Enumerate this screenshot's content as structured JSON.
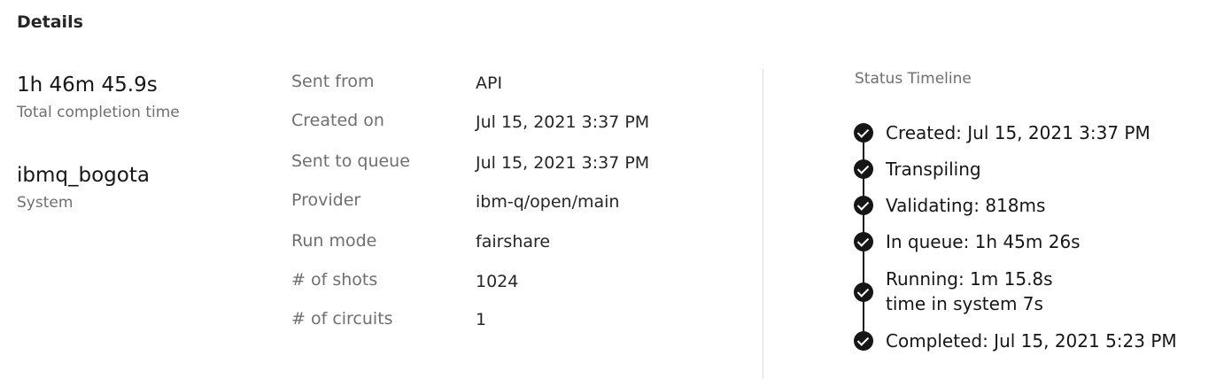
{
  "section_title": "Details",
  "summary": {
    "completion_time": "1h 46m 45.9s",
    "completion_time_label": "Total completion time",
    "system_name": "ibmq_bogota",
    "system_label": "System"
  },
  "properties": [
    {
      "label": "Sent from",
      "value": "API"
    },
    {
      "label": "Created on",
      "value": "Jul 15, 2021 3:37 PM"
    },
    {
      "label": "Sent to queue",
      "value": "Jul 15, 2021 3:37 PM"
    },
    {
      "label": "Provider",
      "value": "ibm-q/open/main"
    },
    {
      "label": "Run mode",
      "value": "fairshare"
    },
    {
      "label": "# of shots",
      "value": "1024"
    },
    {
      "label": "# of circuits",
      "value": "1"
    }
  ],
  "timeline": {
    "title": "Status Timeline",
    "steps": [
      {
        "text": "Created: Jul 15, 2021 3:37 PM",
        "icon": "checkmark-filled-icon"
      },
      {
        "text": "Transpiling",
        "icon": "checkmark-filled-icon"
      },
      {
        "text": "Validating: 818ms",
        "icon": "checkmark-filled-icon"
      },
      {
        "text": "In queue: 1h 45m 26s",
        "icon": "checkmark-filled-icon"
      },
      {
        "text": "Running: 1m 15.8s",
        "subtext": "time in system 7s",
        "icon": "checkmark-filled-icon"
      },
      {
        "text": "Completed: Jul 15, 2021 5:23 PM",
        "icon": "checkmark-filled-icon"
      }
    ]
  }
}
